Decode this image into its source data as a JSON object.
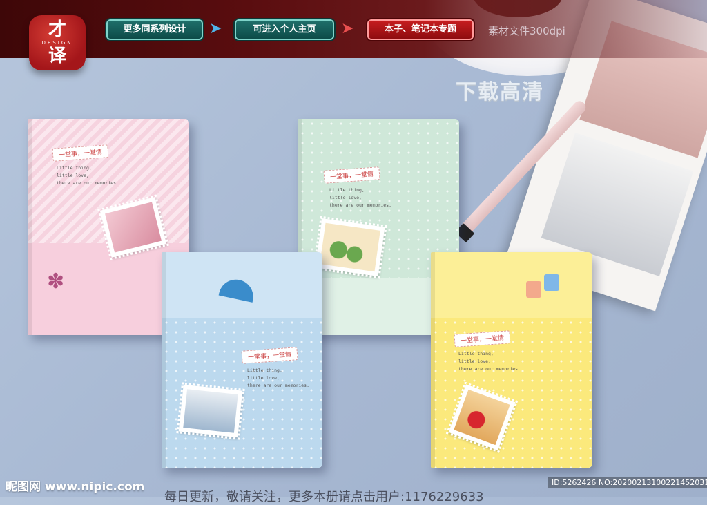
{
  "logo": {
    "char_top": "才",
    "sub": "DESIGN",
    "char_bottom": "译"
  },
  "nav": {
    "link1": "更多同系列设计",
    "link2": "可进入个人主页",
    "link3": "本子、笔记本专题",
    "filesize": "素材文件300dpi"
  },
  "overlay_title": "下载高清",
  "books": {
    "pink": {
      "tag": "一堂事，一堂情",
      "lines": [
        "Little thing,",
        "little love,",
        "there are our memories."
      ]
    },
    "green": {
      "tag": "一堂事，一堂情",
      "lines": [
        "Little thing,",
        "little love,",
        "there are our memories."
      ]
    },
    "blue": {
      "tag": "一堂事，一堂情",
      "lines": [
        "Little thing,",
        "little love,",
        "there are our memories."
      ]
    },
    "yellow": {
      "tag": "一堂事，一堂情",
      "lines": [
        "Little thing,",
        "little love,",
        "there are our memories."
      ]
    }
  },
  "footer": {
    "watermark": "昵图网 www.nipic.com",
    "promo": "每日更新，敬请关注，更多本册请点击用户:1176229633",
    "id": "ID:5262426 NO:20200213100221452031"
  },
  "colors": {
    "topbar": "#5a0d0f",
    "accent_teal": "#1f6f6a",
    "accent_red": "#c61d1f"
  }
}
